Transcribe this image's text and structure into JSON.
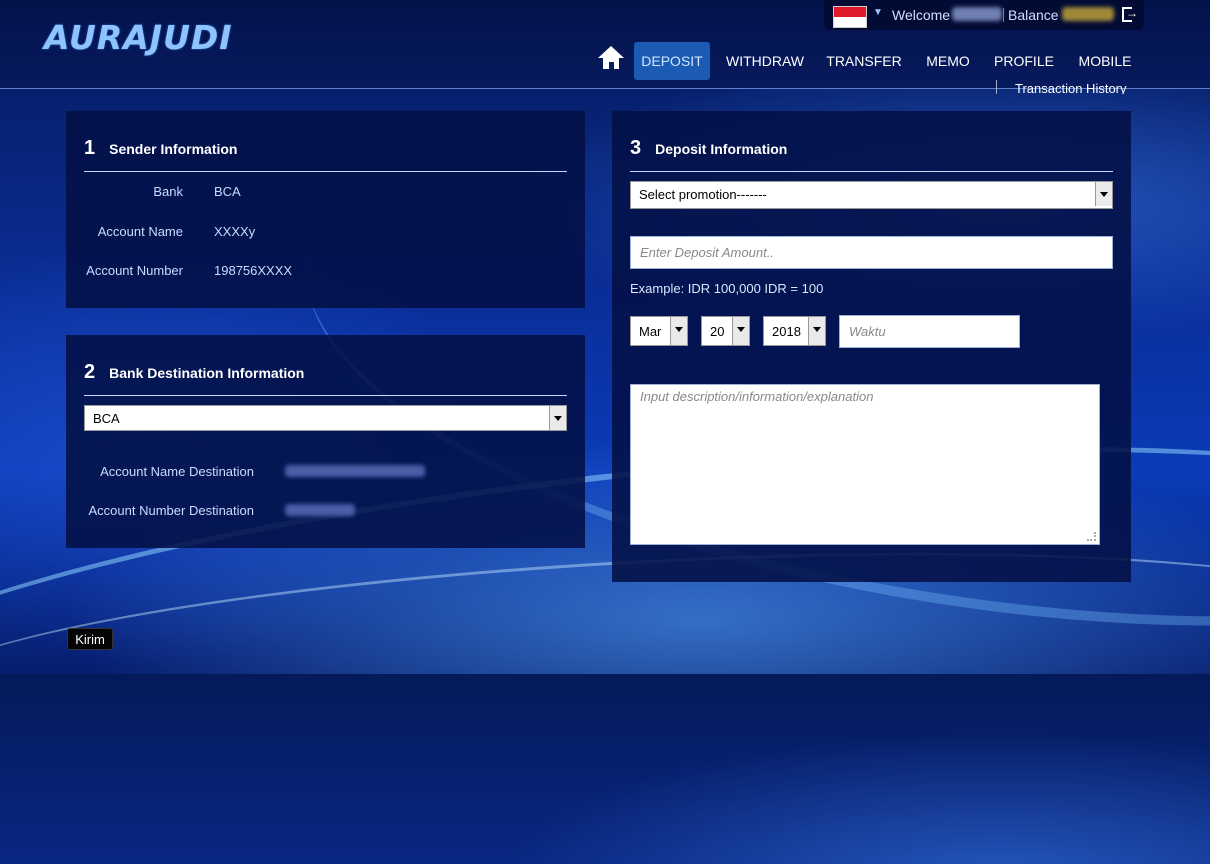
{
  "header": {
    "logo": "AURAJUDI",
    "welcome_label": "Welcome",
    "balance_label": "Balance",
    "nav": [
      "DEPOSIT",
      "WITHDRAW",
      "TRANSFER",
      "MEMO",
      "PROFILE",
      "MOBILE"
    ],
    "subnav": "Transaction History"
  },
  "sender": {
    "number": "1",
    "title": "Sender Information",
    "rows": [
      {
        "label": "Bank",
        "value": "BCA"
      },
      {
        "label": "Account Name",
        "value": "XXXXy"
      },
      {
        "label": "Account Number",
        "value": "198756XXXX"
      }
    ]
  },
  "destination": {
    "number": "2",
    "title": "Bank Destination Information",
    "bank_selected": "BCA",
    "rows": [
      {
        "label": "Account Name Destination"
      },
      {
        "label": "Account Number Destination"
      }
    ]
  },
  "deposit": {
    "number": "3",
    "title": "Deposit Information",
    "promotion_selected": "Select promotion-------",
    "amount_placeholder": "Enter Deposit Amount..",
    "example": "Example: IDR 100,000 IDR = 100",
    "month": "Mar",
    "day": "20",
    "year": "2018",
    "time_placeholder": "Waktu",
    "description_placeholder": "Input description/information/explanation"
  },
  "submit_label": "Kirim",
  "colors": {
    "active_nav": "#1b5bb4",
    "panel": "#03104a",
    "accent": "#8fc3ff"
  }
}
